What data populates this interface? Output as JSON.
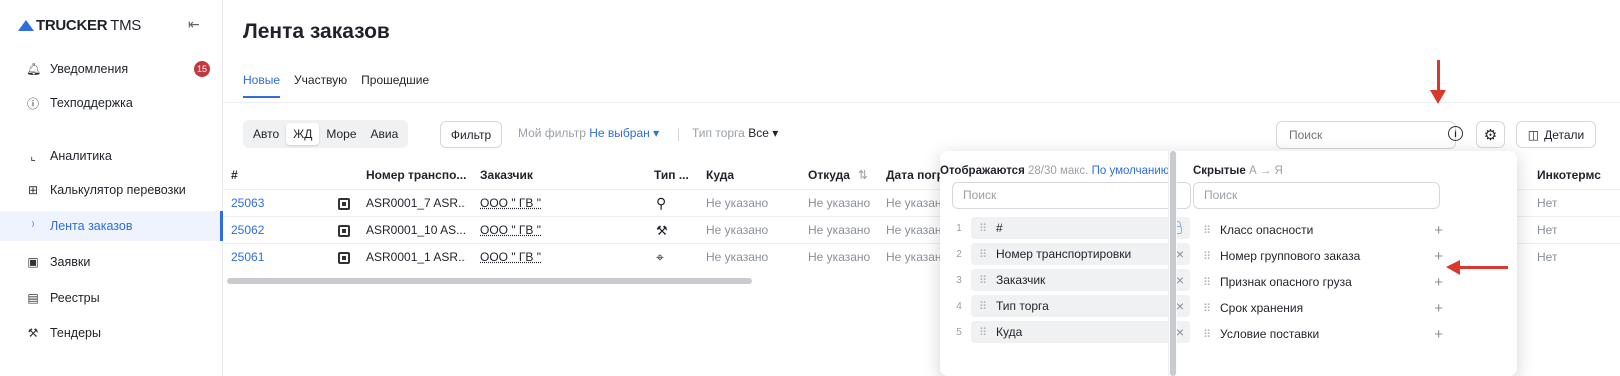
{
  "app": {
    "logo_bold": "TRUCKER",
    "logo_thin": "TMS",
    "collapse_icon": "collapse-left-icon"
  },
  "sidebar": {
    "items": [
      {
        "label": "Уведомления",
        "icon": "bell-icon",
        "badge": "15"
      },
      {
        "label": "Техподдержка",
        "icon": "help-circle-icon"
      },
      {
        "label": "Аналитика",
        "icon": "chart-line-icon"
      },
      {
        "label": "Калькулятор перевозки",
        "icon": "calculator-icon"
      },
      {
        "label": "Лента заказов",
        "icon": "feed-icon",
        "active": true
      },
      {
        "label": "Заявки",
        "icon": "document-icon"
      },
      {
        "label": "Реестры",
        "icon": "register-icon"
      },
      {
        "label": "Тендеры",
        "icon": "gavel-icon"
      }
    ]
  },
  "page": {
    "title": "Лента заказов"
  },
  "tabs": [
    "Новые",
    "Участвую",
    "Прошедшие"
  ],
  "toolbar": {
    "modes": [
      "Авто",
      "ЖД",
      "Море",
      "Авиа"
    ],
    "active_mode": "ЖД",
    "filter_label": "Фильтр",
    "my_filter_label": "Мой фильтр",
    "my_filter_value": "Не выбран",
    "trade_type_label": "Тип торга",
    "trade_type_value": "Все",
    "search_placeholder": "Поиск",
    "details_label": "Детали"
  },
  "table": {
    "columns": [
      "#",
      "Номер транспо...",
      "Заказчик",
      "Тип ...",
      "Куда",
      "Откуда",
      "Дата погр",
      "Инкотермс"
    ],
    "rows": [
      {
        "id": "25063",
        "transport": "ASR0001_7 ASR...",
        "customer": "ООО \" ГВ \"",
        "type_icon": "search-gear-icon",
        "to": "Не указано",
        "from": "Не указано",
        "date": "Не указан",
        "incoterms": "Нет"
      },
      {
        "id": "25062",
        "transport": "ASR0001_10 AS...",
        "customer": "ООО \" ГВ \"",
        "type_icon": "gavel-icon",
        "to": "Не указано",
        "from": "Не указано",
        "date": "Не указан",
        "incoterms": "Нет"
      },
      {
        "id": "25061",
        "transport": "ASR0001_1 ASR...",
        "customer": "ООО \" ГВ \"",
        "type_icon": "target-icon",
        "to": "Не указано",
        "from": "Не указано",
        "date": "Не указан",
        "incoterms": "Нет"
      }
    ]
  },
  "columns_panel": {
    "visible_title": "Отображаются",
    "visible_count": "28/30 макс.",
    "default_link": "По умолчанию",
    "visible_search_placeholder": "Поиск",
    "visible_items": [
      {
        "n": "1",
        "label": "#",
        "locked": true
      },
      {
        "n": "2",
        "label": "Номер транспортировки"
      },
      {
        "n": "3",
        "label": "Заказчик"
      },
      {
        "n": "4",
        "label": "Тип торга"
      },
      {
        "n": "5",
        "label": "Куда"
      }
    ],
    "hidden_title": "Скрытые",
    "hidden_sort": "А → Я",
    "hidden_search_placeholder": "Поиск",
    "hidden_items": [
      "Класс опасности",
      "Номер группового заказа",
      "Признак опасного груза",
      "Срок хранения",
      "Условие поставки"
    ]
  },
  "colors": {
    "accent": "#2e6fdb",
    "badge": "#c6373b",
    "arrow": "#d8382e"
  }
}
